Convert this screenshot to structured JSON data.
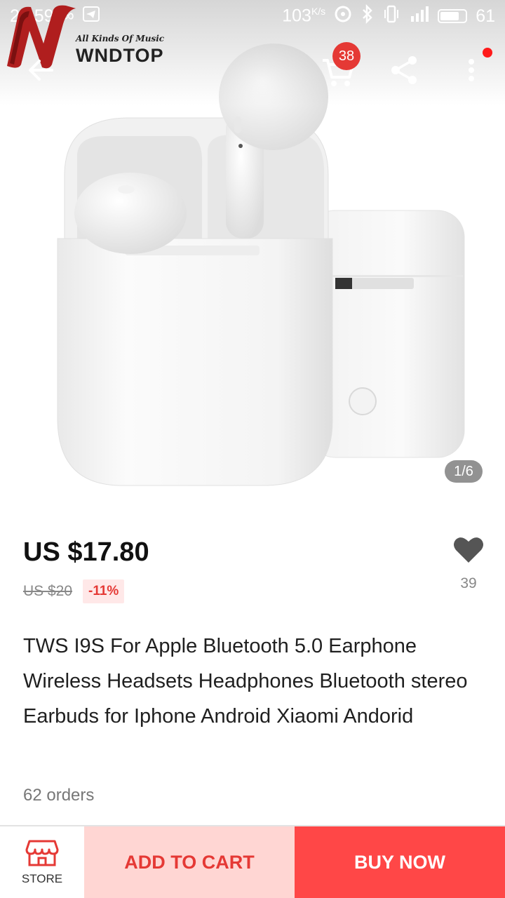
{
  "status_bar": {
    "time": "21:59",
    "net_speed": "103",
    "net_unit": "K/s",
    "battery": "61",
    "icons": [
      "infinity-icon",
      "telegram-icon",
      "hotspot-icon",
      "bluetooth-icon",
      "vibrate-icon",
      "signal-4g-icon",
      "battery-icon"
    ]
  },
  "watermark": {
    "tagline": "All Kinds Of Music",
    "name": "WNDTOP"
  },
  "header": {
    "cart_count": "38",
    "icons": [
      "back-arrow-icon",
      "cart-icon",
      "share-icon",
      "more-vert-icon"
    ]
  },
  "gallery": {
    "counter": "1/6"
  },
  "product": {
    "price": "US $17.80",
    "old_price": "US $20",
    "discount": "-11%",
    "wishlist_count": "39",
    "title": "TWS I9S For Apple Bluetooth 5.0 Earphone Wireless Headsets Headphones Bluetooth stereo Earbuds for Iphone Android Xiaomi Andorid",
    "orders": "62 orders"
  },
  "bottom_bar": {
    "store_label": "STORE",
    "add_to_cart": "ADD TO CART",
    "buy_now": "BUY NOW"
  },
  "colors": {
    "accent_red": "#ff4747",
    "badge_red": "#e53935",
    "cart_bg": "#ffd6d3",
    "logo_red": "#b01e1e"
  }
}
